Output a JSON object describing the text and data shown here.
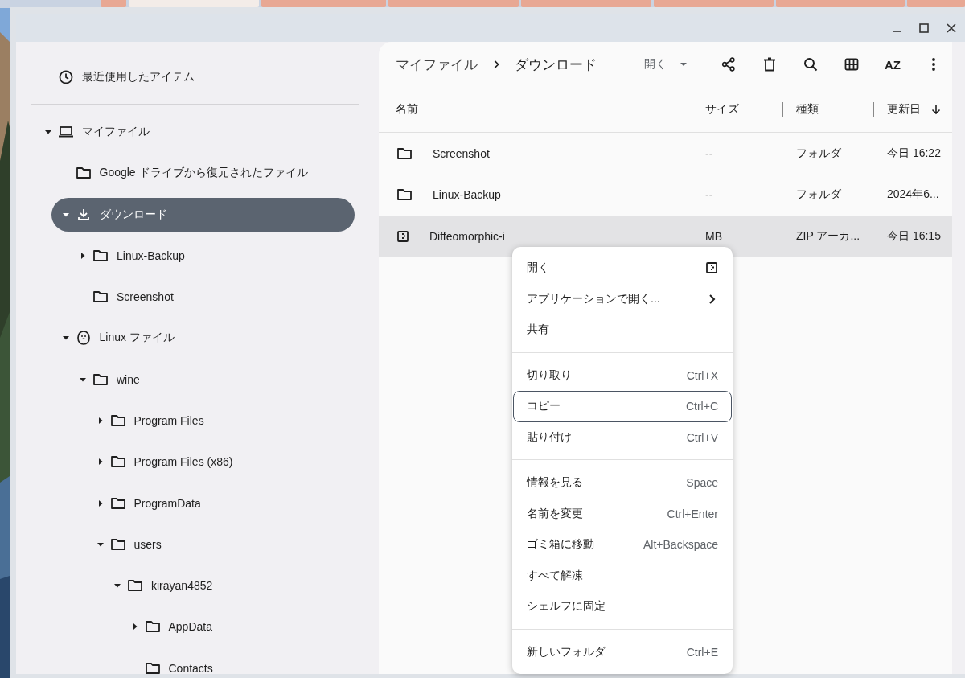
{
  "browser_tabs": [
    {
      "selected": false
    },
    {
      "selected": true
    },
    {
      "selected": false
    },
    {
      "selected": false
    },
    {
      "selected": false
    },
    {
      "selected": false
    },
    {
      "selected": false
    },
    {
      "selected": false
    }
  ],
  "sidebar": {
    "recent": {
      "label": "最近使用したアイテム",
      "kind": "recent",
      "selected": false
    },
    "tree": [
      {
        "label": "マイファイル",
        "kind": "computer",
        "selected": false,
        "expanded": true,
        "children": [
          {
            "label": "Google ドライブから復元されたファイル",
            "kind": "folder",
            "selected": false
          },
          {
            "label": "ダウンロード",
            "kind": "download",
            "selected": true,
            "expanded": true,
            "children": [
              {
                "label": "Linux-Backup",
                "kind": "folder",
                "selected": false,
                "expanded": false
              },
              {
                "label": "Screenshot",
                "kind": "folder",
                "selected": false
              }
            ]
          },
          {
            "label": "Linux ファイル",
            "kind": "linux",
            "selected": false,
            "expanded": true,
            "children": [
              {
                "label": "wine",
                "kind": "folder",
                "selected": false,
                "expanded": true,
                "children": [
                  {
                    "label": "Program Files",
                    "kind": "folder",
                    "selected": false,
                    "expanded": false
                  },
                  {
                    "label": "Program Files (x86)",
                    "kind": "folder",
                    "selected": false,
                    "expanded": false
                  },
                  {
                    "label": "ProgramData",
                    "kind": "folder",
                    "selected": false,
                    "expanded": false
                  },
                  {
                    "label": "users",
                    "kind": "folder",
                    "selected": false,
                    "expanded": true,
                    "children": [
                      {
                        "label": "kirayan4852",
                        "kind": "folder",
                        "selected": false,
                        "expanded": true,
                        "children": [
                          {
                            "label": "AppData",
                            "kind": "folder",
                            "selected": false,
                            "expanded": false
                          },
                          {
                            "label": "Contacts",
                            "kind": "folder",
                            "selected": false
                          }
                        ]
                      }
                    ]
                  }
                ]
              }
            ]
          }
        ]
      }
    ]
  },
  "breadcrumb": [
    "マイファイル",
    "ダウンロード"
  ],
  "toolbar": {
    "open_label": "開く",
    "sort_label": "AZ"
  },
  "table": {
    "columns": [
      {
        "label": "名前",
        "sorted": false
      },
      {
        "label": "サイズ",
        "sorted": false
      },
      {
        "label": "種類",
        "sorted": false
      },
      {
        "label": "更新日",
        "sorted": true
      }
    ],
    "rows": [
      {
        "kind": "folder",
        "name": "Screenshot",
        "size": "--",
        "type": "フォルダ",
        "modified": "今日 16:22",
        "selected": false
      },
      {
        "kind": "folder",
        "name": "Linux-Backup",
        "size": "--",
        "type": "フォルダ",
        "modified": "2024年6...",
        "selected": false
      },
      {
        "kind": "zip",
        "name": "Diffeomorphic-i",
        "size": "MB",
        "type": "ZIP アーカ...",
        "modified": "今日 16:15",
        "selected": true
      }
    ]
  },
  "context_menu": {
    "sections": [
      [
        {
          "label": "開く",
          "kind": "zip",
          "focused": false
        },
        {
          "label": "アプリケーションで開く...",
          "kind": "submenu",
          "focused": false
        },
        {
          "label": "共有",
          "kind": "plain",
          "focused": false
        }
      ],
      [
        {
          "label": "切り取り",
          "kind": "plain",
          "shortcut": "Ctrl+X",
          "focused": false
        },
        {
          "label": "コピー",
          "kind": "plain",
          "shortcut": "Ctrl+C",
          "focused": true
        },
        {
          "label": "貼り付け",
          "kind": "plain",
          "shortcut": "Ctrl+V",
          "focused": false
        }
      ],
      [
        {
          "label": "情報を見る",
          "kind": "plain",
          "shortcut": "Space",
          "focused": false
        },
        {
          "label": "名前を変更",
          "kind": "plain",
          "shortcut": "Ctrl+Enter",
          "focused": false
        },
        {
          "label": "ゴミ箱に移動",
          "kind": "plain",
          "shortcut": "Alt+Backspace",
          "focused": false
        },
        {
          "label": "すべて解凍",
          "kind": "plain",
          "focused": false
        },
        {
          "label": "シェルフに固定",
          "kind": "plain",
          "focused": false
        }
      ],
      [
        {
          "label": "新しいフォルダ",
          "kind": "plain",
          "shortcut": "Ctrl+E",
          "focused": false
        }
      ]
    ]
  }
}
